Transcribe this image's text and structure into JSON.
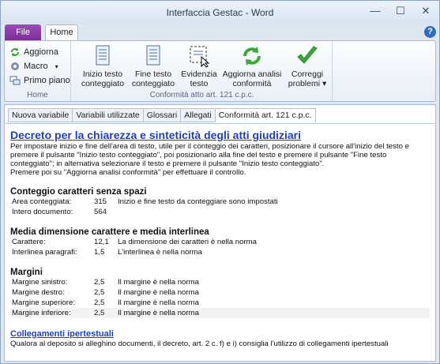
{
  "window": {
    "title": "Interfaccia Gestac - Word"
  },
  "ribbon_tabs": {
    "file": "File",
    "home": "Home"
  },
  "home_group": {
    "label": "Home",
    "items": [
      "Aggiorna",
      "Macro",
      "Primo piano"
    ]
  },
  "conf_group": {
    "label": "Conformità atto art. 121 c.p.c.",
    "buttons": [
      {
        "l1": "Inizio testo",
        "l2": "conteggiato"
      },
      {
        "l1": "Fine testo",
        "l2": "conteggiato"
      },
      {
        "l1": "Evidenzia",
        "l2": "testo"
      },
      {
        "l1": "Aggiorna analisi",
        "l2": "conformità"
      },
      {
        "l1": "Correggi",
        "l2": "problemi ▾"
      }
    ]
  },
  "subtabs": [
    "Nuova variabile",
    "Variabili utilizzate",
    "Glossari",
    "Allegati",
    "Conformità art. 121 c.p.c."
  ],
  "doc": {
    "title": "Decreto per la chiarezza e sinteticità degli atti giudiziari",
    "intro": [
      "Per impostare inizio e fine dell'area di testo, utile per il conteggio dei caratteri, posizionare il cursore all'inizio del testo e",
      "premere il pulsante \"Inizio testo conteggiato\", poi posizionarlo alla fine del testo e premere il pulsante \"Fine testo",
      "conteggiato\"; in alternativa selezionare il testo e premere il pulsante \"Inizio testo conteggiato\".",
      "Premere poi su \"Aggiorna analisi conformità\" per effettuare il controllo."
    ],
    "sections": [
      {
        "heading": "Conteggio caratteri senza spazi",
        "rows": [
          {
            "k": "Area conteggiata:",
            "v": "315",
            "n": "Inizio e fine testo da conteggiare sono impostati"
          },
          {
            "k": "Intero documento:",
            "v": "564",
            "n": ""
          }
        ]
      },
      {
        "heading": "Media dimensione carattere e media interlinea",
        "rows": [
          {
            "k": "Carattere:",
            "v": "12,1",
            "n": "La dimensione dei caratteri è nella norma"
          },
          {
            "k": "Interlinea paragrafi:",
            "v": "1,5",
            "n": "L'interlinea è nella norma"
          }
        ]
      },
      {
        "heading": "Margini",
        "rows": [
          {
            "k": "Margine sinistro:",
            "v": "2,5",
            "n": "Il margine è nella norma"
          },
          {
            "k": "Margine destro:",
            "v": "2,5",
            "n": "Il margine è nella norma"
          },
          {
            "k": "Margine superiore:",
            "v": "2,5",
            "n": "Il margine è nella norma"
          },
          {
            "k": "Margine inferiore:",
            "v": "2,5",
            "n": "Il margine è nella norma"
          }
        ]
      }
    ],
    "links_heading": "Collegamenti ipertestuali",
    "links_text": "Qualora al deposito si alleghino documenti, il decreto, art. 2 c. f) e i) consiglia l'utilizzo di collegamenti ipertestuali"
  },
  "colors": {
    "file_tab": "#8a3aa8",
    "link": "#1f3fbf",
    "accent_green": "#39a935"
  }
}
